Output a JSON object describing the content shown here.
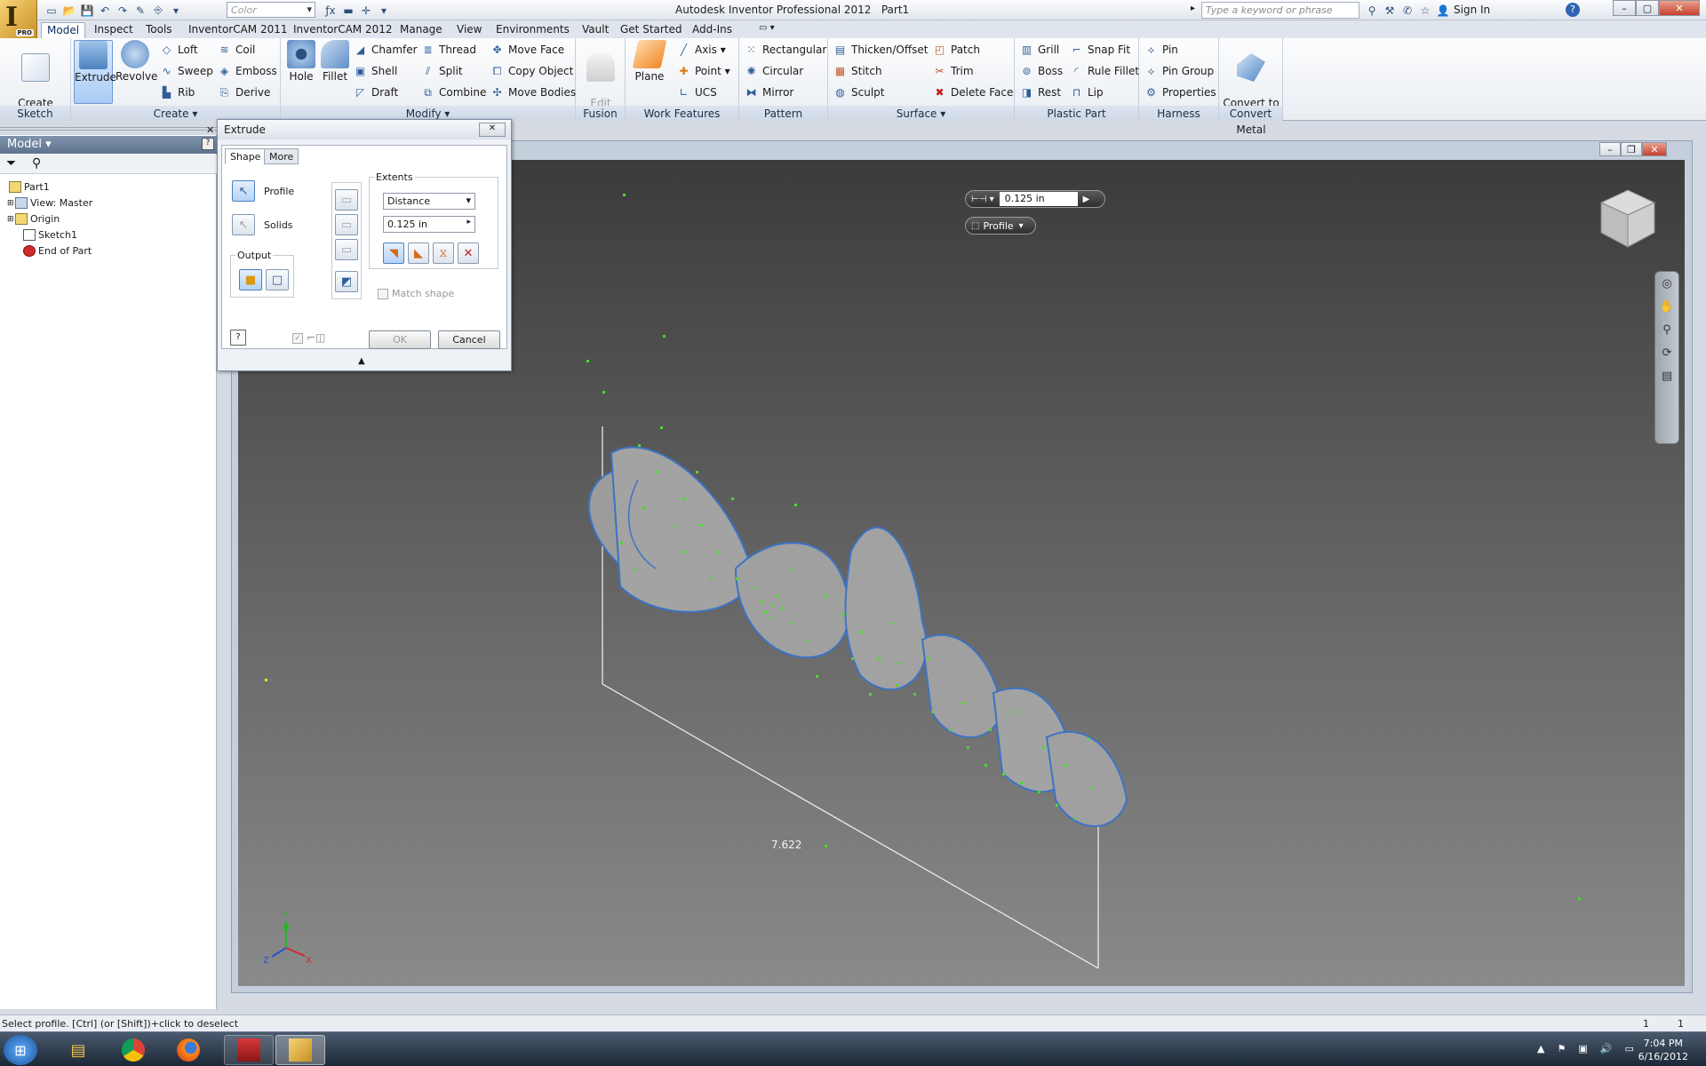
{
  "titlebar": {
    "title": "Autodesk Inventor Professional 2012",
    "document": "Part1",
    "color_combo": "Color",
    "search_placeholder": "Type a keyword or phrase",
    "sign_in": "Sign In",
    "app_badge": "PRO"
  },
  "tabs": [
    "Model",
    "Inspect",
    "Tools",
    "InventorCAM 2011",
    "InventorCAM 2012",
    "Manage",
    "View",
    "Environments",
    "Vault",
    "Get Started",
    "Add-Ins"
  ],
  "active_tab": "Model",
  "ribbon": {
    "sketch": {
      "label": "Sketch",
      "create_2d_sketch": "Create\n2D Sketch"
    },
    "create": {
      "label": "Create",
      "extrude": "Extrude",
      "revolve": "Revolve",
      "loft": "Loft",
      "sweep": "Sweep",
      "rib": "Rib",
      "coil": "Coil",
      "emboss": "Emboss",
      "derive": "Derive"
    },
    "modify": {
      "label": "Modify",
      "hole": "Hole",
      "fillet": "Fillet",
      "chamfer": "Chamfer",
      "shell": "Shell",
      "draft": "Draft",
      "thread": "Thread",
      "split": "Split",
      "combine": "Combine",
      "move_face": "Move Face",
      "copy_object": "Copy Object",
      "move_bodies": "Move Bodies"
    },
    "fusion": {
      "label": "Fusion",
      "edit_form": "Edit\nForm"
    },
    "work_features": {
      "label": "Work Features",
      "plane": "Plane",
      "axis": "Axis",
      "point": "Point",
      "ucs": "UCS"
    },
    "pattern": {
      "label": "Pattern",
      "rectangular": "Rectangular",
      "circular": "Circular",
      "mirror": "Mirror"
    },
    "surface": {
      "label": "Surface",
      "thicken_offset": "Thicken/Offset",
      "stitch": "Stitch",
      "sculpt": "Sculpt",
      "patch": "Patch",
      "trim": "Trim",
      "delete_face": "Delete Face"
    },
    "plastic_part": {
      "label": "Plastic Part",
      "grill": "Grill",
      "boss": "Boss",
      "rest": "Rest",
      "snap_fit": "Snap Fit",
      "rule_fillet": "Rule Fillet",
      "lip": "Lip"
    },
    "harness": {
      "label": "Harness",
      "pin": "Pin",
      "pin_group": "Pin Group",
      "properties": "Properties"
    },
    "convert": {
      "label": "Convert",
      "convert_sheet_metal": "Convert to\nSheet Metal"
    }
  },
  "browser": {
    "title": "Model",
    "items": [
      "Part1",
      "View: Master",
      "Origin",
      "Sketch1",
      "End of Part"
    ]
  },
  "extrude_dialog": {
    "title": "Extrude",
    "tab_shape": "Shape",
    "tab_more": "More",
    "profile": "Profile",
    "solids": "Solids",
    "output": "Output",
    "extents": "Extents",
    "extents_type": "Distance",
    "distance": "0.125 in",
    "match_shape": "Match shape",
    "ok": "OK",
    "cancel": "Cancel"
  },
  "mini_toolbar": {
    "distance": "0.125 in",
    "profile": "Profile"
  },
  "viewport": {
    "dimension": "7.622",
    "sketch_text": "Duckess"
  },
  "status": {
    "message": "Select profile. [Ctrl] (or [Shift])+click to deselect",
    "count1": "1",
    "count2": "1"
  },
  "taskbar": {
    "time": "7:04 PM",
    "date": "6/16/2012"
  }
}
